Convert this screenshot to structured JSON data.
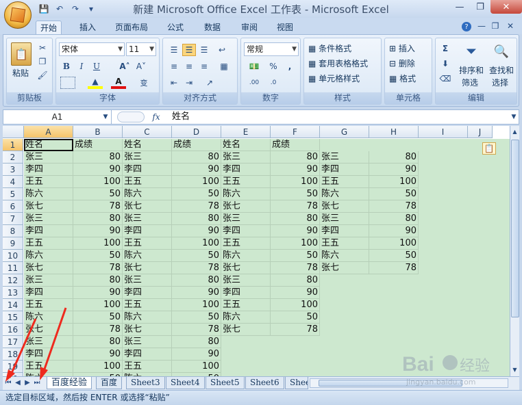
{
  "window": {
    "title": "新建 Microsoft Office Excel 工作表 - Microsoft Excel"
  },
  "tabs": [
    "开始",
    "插入",
    "页面布局",
    "公式",
    "数据",
    "审阅",
    "视图"
  ],
  "ribbon": {
    "clipboard": {
      "label": "剪贴板",
      "paste": "粘贴"
    },
    "font": {
      "label": "字体",
      "name": "宋体",
      "size": "11",
      "bold": "B",
      "italic": "I",
      "underline": "U"
    },
    "align": {
      "label": "对齐方式"
    },
    "number": {
      "label": "数字",
      "format": "常规",
      "percent": "%"
    },
    "styles": {
      "label": "样式",
      "cond": "条件格式",
      "table": "套用表格格式",
      "cell": "单元格样式"
    },
    "cells": {
      "label": "单元格",
      "insert": "插入",
      "delete": "删除",
      "format": "格式"
    },
    "edit": {
      "label": "编辑",
      "sort1": "排序和",
      "sort2": "筛选",
      "find1": "查找和",
      "find2": "选择"
    }
  },
  "formula": {
    "namebox": "A1",
    "fx": "fx",
    "value": "姓名"
  },
  "columns": [
    "A",
    "B",
    "C",
    "D",
    "E",
    "F",
    "G",
    "H",
    "I",
    "J"
  ],
  "rows": [
    "1",
    "2",
    "3",
    "4",
    "5",
    "6",
    "7",
    "8",
    "9",
    "10",
    "11",
    "12",
    "13",
    "14",
    "15",
    "16",
    "17",
    "18",
    "19",
    "20"
  ],
  "header_row": [
    "姓名",
    "成绩",
    "姓名",
    "成绩",
    "姓名",
    "成绩"
  ],
  "names": [
    "张三",
    "李四",
    "王五",
    "陈六",
    "张七",
    "张三",
    "李四",
    "王五",
    "陈六",
    "张七",
    "张三",
    "李四",
    "王五",
    "陈六",
    "张七",
    "张三",
    "李四",
    "王五",
    "陈六"
  ],
  "scores": [
    "80",
    "90",
    "100",
    "50",
    "78",
    "80",
    "90",
    "100",
    "50",
    "78",
    "80",
    "90",
    "100",
    "50",
    "78",
    "80",
    "90",
    "100",
    "50"
  ],
  "sheets": [
    "百度经验",
    "百度",
    "Sheet3",
    "Sheet4",
    "Sheet5",
    "Sheet6",
    "Shee"
  ],
  "status": "选定目标区域，然后按 ENTER 或选择“粘贴”",
  "watermark": {
    "brand": "Bai",
    "brand2": "经验",
    "url": "jingyan.baidu.com"
  }
}
